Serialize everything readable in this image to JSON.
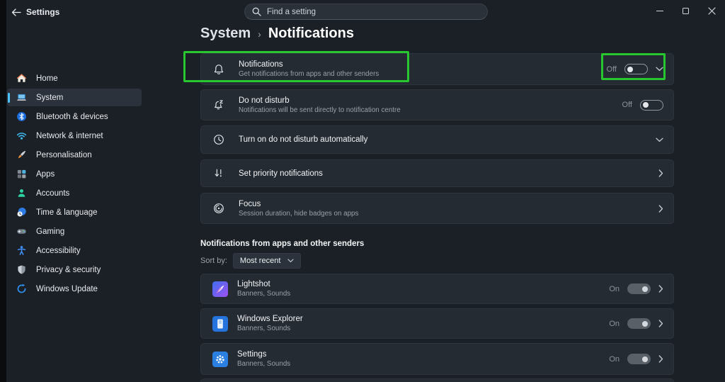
{
  "titlebar": {
    "app_label": "Settings",
    "search_placeholder": "Find a setting"
  },
  "sidebar": {
    "items": [
      {
        "label": "Home",
        "icon": "home-icon"
      },
      {
        "label": "System",
        "icon": "system-icon",
        "selected": true
      },
      {
        "label": "Bluetooth & devices",
        "icon": "bluetooth-icon"
      },
      {
        "label": "Network & internet",
        "icon": "network-icon"
      },
      {
        "label": "Personalisation",
        "icon": "personalisation-icon"
      },
      {
        "label": "Apps",
        "icon": "apps-icon"
      },
      {
        "label": "Accounts",
        "icon": "accounts-icon"
      },
      {
        "label": "Time & language",
        "icon": "time-language-icon"
      },
      {
        "label": "Gaming",
        "icon": "gaming-icon"
      },
      {
        "label": "Accessibility",
        "icon": "accessibility-icon"
      },
      {
        "label": "Privacy & security",
        "icon": "privacy-icon"
      },
      {
        "label": "Windows Update",
        "icon": "windows-update-icon"
      }
    ]
  },
  "breadcrumb": {
    "parent": "System",
    "separator": "›",
    "current": "Notifications"
  },
  "rows": {
    "notifications": {
      "title": "Notifications",
      "subtitle": "Get notifications from apps and other senders",
      "state": "Off"
    },
    "dnd": {
      "title": "Do not disturb",
      "subtitle": "Notifications will be sent directly to notification centre",
      "state": "Off"
    },
    "dnd_auto": {
      "title": "Turn on do not disturb automatically"
    },
    "priority": {
      "title": "Set priority notifications"
    },
    "focus": {
      "title": "Focus",
      "subtitle": "Session duration, hide badges on apps"
    }
  },
  "apps_section": {
    "header": "Notifications from apps and other senders",
    "sort_label": "Sort by:",
    "sort_value": "Most recent",
    "apps": [
      {
        "name": "Lightshot",
        "subtitle": "Banners, Sounds",
        "state": "On"
      },
      {
        "name": "Windows Explorer",
        "subtitle": "Banners, Sounds",
        "state": "On"
      },
      {
        "name": "Settings",
        "subtitle": "Banners, Sounds",
        "state": "On"
      }
    ]
  },
  "colors": {
    "highlight_green": "#28c62f",
    "accent_blue": "#4cc2ff",
    "background": "#1b2027",
    "card": "#252b33"
  }
}
